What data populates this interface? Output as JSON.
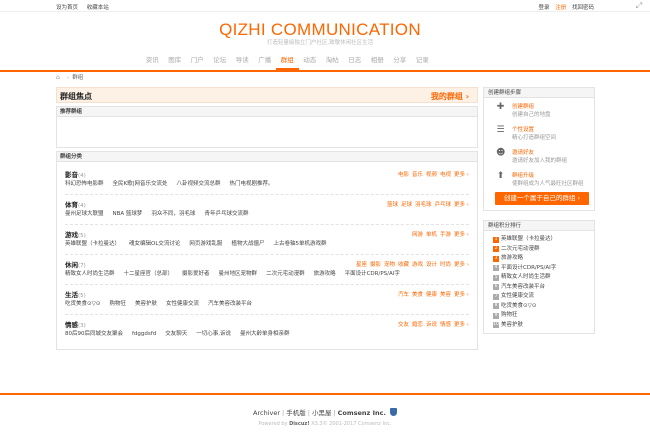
{
  "topbar": {
    "left": [
      "设为首页",
      "收藏本站"
    ],
    "login": "登录",
    "register": "注册",
    "recover": "找回密码",
    "expand_icon": "expand-icon"
  },
  "header": {
    "logo": "QIZHI COMMUNICATION",
    "slogan": "打造轻量级独立门户社区,致敬休闲社区生活"
  },
  "nav": [
    "资讯",
    "图库",
    "门户",
    "论坛",
    "导读",
    "广播",
    "群组",
    "动态",
    "淘帖",
    "日志",
    "相册",
    "分享",
    "记录"
  ],
  "nav_active": "群组",
  "breadcrumb": {
    "current": "群组"
  },
  "main": {
    "focus_title": "群组焦点",
    "my_groups": "我的群组 ›",
    "recommended": "推荐群组",
    "categories_title": "群组分类",
    "categories": [
      {
        "name": "影音",
        "count": "(4)",
        "subs": [
          "电影",
          "音乐",
          "视频",
          "电视",
          "更多 ›"
        ],
        "groups": [
          "科幻恐怖电影群",
          "全民K歌|网音乐交流处",
          "八卦视频交流总群",
          "热门电视剧推荐。"
        ]
      },
      {
        "name": "体育",
        "count": "(4)",
        "subs": [
          "篮球",
          "足球",
          "羽毛球",
          "乒乓球",
          "更多 ›"
        ],
        "groups": [
          "曼州足球大联盟",
          "NBA 篮球梦",
          "羽众不同，羽毛球",
          "青年乒乓球交流群"
        ]
      },
      {
        "name": "游戏",
        "count": "(5)",
        "subs": [
          "网游",
          "单机",
          "手游",
          "更多 ›"
        ],
        "groups": [
          "英雄联盟（卡拉曼达）",
          "魂女编辑OL交流讨论",
          "网页游戏乱服",
          "植物大战僵尸",
          "上古卷轴5单机游戏群"
        ]
      },
      {
        "name": "休闲",
        "count": "(7)",
        "subs": [
          "星座",
          "摄影",
          "宠物",
          "收藏",
          "游戏",
          "设计",
          "时尚",
          "更多 ›"
        ],
        "groups": [
          "精致女人时尚生活群",
          "十二星座官（总部）",
          "摄影爱好者",
          "曼州地区宠物群",
          "二次元宅动漫群",
          "旅游攻略",
          "平面设计CDR/PS/AI字"
        ]
      },
      {
        "name": "生活",
        "count": "(5)",
        "subs": [
          "汽车",
          "美食",
          "健康",
          "美容",
          "更多 ›"
        ],
        "groups": [
          "吃货美食⊙▽⊙",
          "购物狂",
          "美容护肤",
          "女性健康交流",
          "汽车美容改装平台"
        ]
      },
      {
        "name": "情感",
        "count": "(3)",
        "subs": [
          "交友",
          "婚恋",
          "诉说",
          "情感",
          "更多 ›"
        ],
        "groups": [
          "80后90后同城交友聚会",
          "fdggdsfd",
          "交友聊天",
          "一切心事,诉说",
          "曼州大龄单身相亲群"
        ]
      }
    ]
  },
  "sidebar": {
    "steps_title": "创建群组步骤",
    "steps": [
      {
        "title": "创建群组",
        "desc": "创建自己的地盘",
        "icon": "plus-icon"
      },
      {
        "title": "个性设置",
        "desc": "精心打造群组空间",
        "icon": "settings-icon"
      },
      {
        "title": "邀请好友",
        "desc": "邀请好友加入我的群组",
        "icon": "invite-icon"
      },
      {
        "title": "群组升级",
        "desc": "使群组成为人气最旺社区群组",
        "icon": "upgrade-icon"
      }
    ],
    "create_button": "创建一个属于自己的群组 ›",
    "rank_title": "群组积分排行",
    "rank": [
      "英雄联盟（卡拉曼达）",
      "二次元宅动漫群",
      "旅游攻略",
      "平面设计CDR/PS/AI字",
      "精致女人时尚生活群",
      "汽车美容改装平台",
      "女性健康交流",
      "吃货美食⊙▽⊙",
      "购物狂",
      "美容护肤"
    ]
  },
  "footer": {
    "links": [
      "Archiver",
      "手机版",
      "小黑屋",
      "Comsenz Inc."
    ],
    "powered_prefix": "Powered by",
    "powered_brand": "Discuz!",
    "powered_suffix": "X3.3© 2001-2017 Comsenz Inc."
  },
  "colors": {
    "accent": "#ff6600",
    "footer_shield": "#3b6aa8"
  }
}
